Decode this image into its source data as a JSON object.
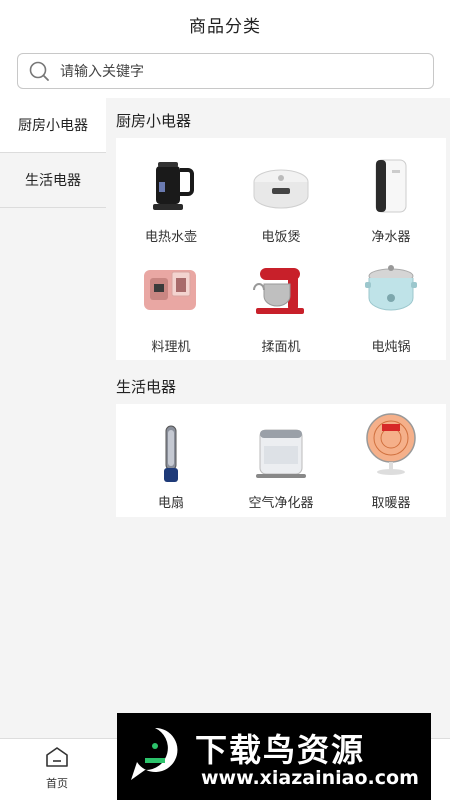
{
  "header": {
    "title": "商品分类"
  },
  "search": {
    "placeholder": "请输入关键字"
  },
  "sidebar": {
    "items": [
      {
        "label": "厨房小电器"
      },
      {
        "label": "生活电器"
      }
    ]
  },
  "sections": [
    {
      "title": "厨房小电器",
      "items": [
        {
          "label": "电热水壶",
          "icon": "kettle-icon"
        },
        {
          "label": "电饭煲",
          "icon": "rice-cooker-icon"
        },
        {
          "label": "净水器",
          "icon": "water-purifier-icon"
        },
        {
          "label": "料理机",
          "icon": "food-processor-icon"
        },
        {
          "label": "揉面机",
          "icon": "stand-mixer-icon"
        },
        {
          "label": "电炖锅",
          "icon": "slow-cooker-icon"
        }
      ]
    },
    {
      "title": "生活电器",
      "items": [
        {
          "label": "电扇",
          "icon": "bladeless-fan-icon"
        },
        {
          "label": "空气净化器",
          "icon": "air-purifier-icon"
        },
        {
          "label": "取暖器",
          "icon": "heater-icon"
        }
      ]
    }
  ],
  "tabbar": {
    "home_label": "首页"
  },
  "banner": {
    "title": "下载鸟资源",
    "url": "www.xiazainiao.com"
  },
  "colors": {
    "background": "#f4f4f4",
    "panel": "#ffffff",
    "banner": "#000000"
  }
}
